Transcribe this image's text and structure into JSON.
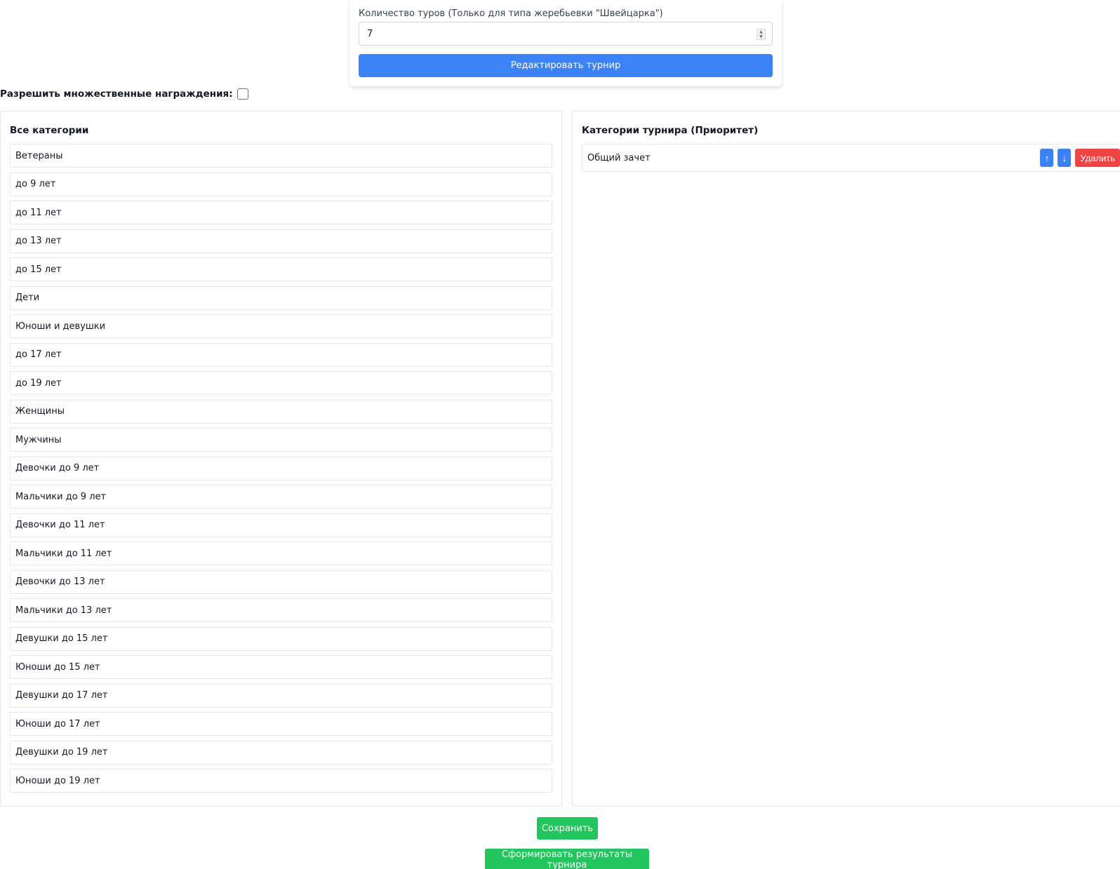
{
  "form": {
    "rounds_label": "Количество туров (Только для типа жеребьевки \"Швейцарка\")",
    "rounds_value": "7",
    "edit_button": "Редактировать турнир"
  },
  "multi_award": {
    "label": "Разрешить множественные награждения:",
    "checked": false
  },
  "all_categories": {
    "title": "Все категории",
    "items": [
      "Ветераны",
      "до 9 лет",
      "до 11 лет",
      "до 13 лет",
      "до 15 лет",
      "Дети",
      "Юноши и девушки",
      "до 17 лет",
      "до 19 лет",
      "Женщины",
      "Мужчины",
      "Девочки до 9 лет",
      "Мальчики до 9 лет",
      "Девочки до 11 лет",
      "Мальчики до 11 лет",
      "Девочки до 13 лет",
      "Мальчики до 13 лет",
      "Девушки до 15 лет",
      "Юноши до 15 лет",
      "Девушки до 17 лет",
      "Юноши до 17 лет",
      "Девушки до 19 лет",
      "Юноши до 19 лет"
    ]
  },
  "tournament_categories": {
    "title": "Категории турнира (Приоритет)",
    "items": [
      {
        "label": "Общий зачет",
        "up": "↑",
        "down": "↓",
        "delete": "Удалить"
      }
    ]
  },
  "actions": {
    "save": "Сохранить",
    "generate_results": "Сформировать результаты турнира"
  },
  "colors": {
    "primary": "#3b82f6",
    "danger": "#ef4444",
    "success": "#22c55e"
  }
}
